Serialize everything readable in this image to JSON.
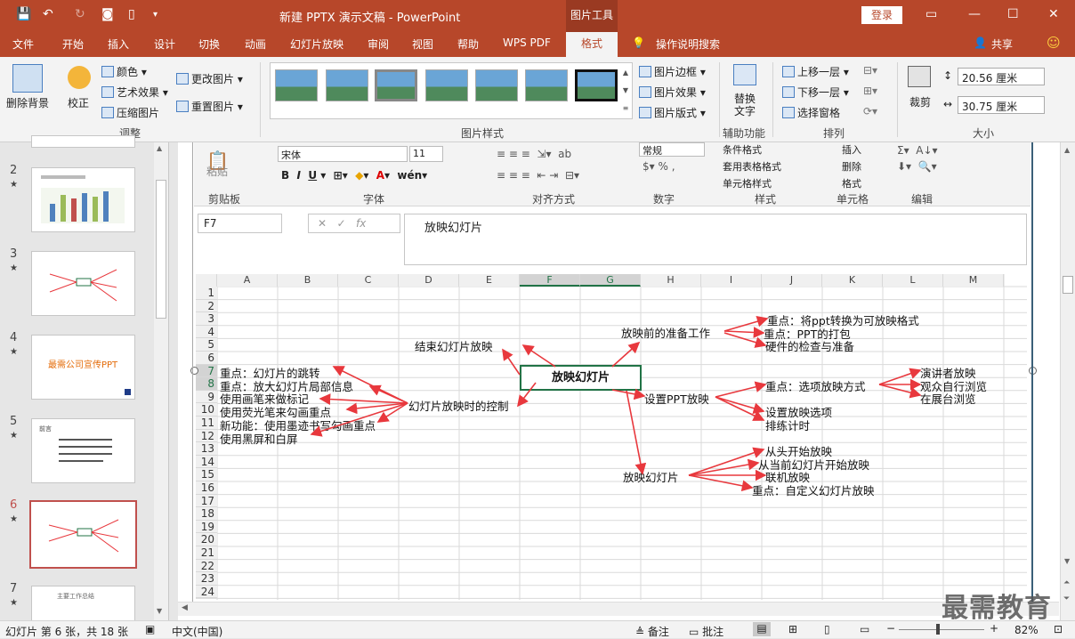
{
  "app": {
    "title": "新建 PPTX 演示文稿 - PowerPoint",
    "context_tab_title": "图片工具",
    "login_label": "登录"
  },
  "tabs": [
    "文件",
    "开始",
    "插入",
    "设计",
    "切换",
    "动画",
    "幻灯片放映",
    "审阅",
    "视图",
    "帮助",
    "WPS PDF",
    "格式",
    "操作说明搜索",
    "共享"
  ],
  "ribbon": {
    "adjust": {
      "remove_bg": "删除背景",
      "correct": "校正",
      "color": "颜色",
      "artistic": "艺术效果",
      "compress": "压缩图片",
      "change": "更改图片",
      "reset": "重置图片",
      "label": "调整"
    },
    "styles": {
      "label": "图片样式",
      "border": "图片边框",
      "effect": "图片效果",
      "layout": "图片版式"
    },
    "accessibility": {
      "alt_text": "替换文字",
      "label": "辅助功能"
    },
    "arrange": {
      "bring_forward": "上移一层",
      "send_backward": "下移一层",
      "selection_pane": "选择窗格",
      "label": "排列"
    },
    "size": {
      "crop": "裁剪",
      "height": "20.56 厘米",
      "width": "30.75 厘米",
      "label": "大小"
    }
  },
  "slides": [
    {
      "num": "2",
      "star": "★"
    },
    {
      "num": "3",
      "star": "★"
    },
    {
      "num": "4",
      "star": "★"
    },
    {
      "num": "5",
      "star": "★"
    },
    {
      "num": "6",
      "star": "★"
    },
    {
      "num": "7",
      "star": "★"
    }
  ],
  "thumb_text": {
    "s4": "最需公司宣传PPT",
    "s5": "前言",
    "s7": "主要工作总结"
  },
  "excel": {
    "ribbon": {
      "paste": "粘贴",
      "clipboard": "剪贴板",
      "font_name": "宋体",
      "font_size": "11",
      "font": "字体",
      "align": "对齐方式",
      "number_format": "常规",
      "number": "数字",
      "cond_format": "条件格式",
      "table_format": "套用表格格式",
      "cell_style": "单元格样式",
      "style": "样式",
      "insert": "插入",
      "delete": "删除",
      "format": "格式",
      "cells": "单元格",
      "edit": "编辑"
    },
    "name_box": "F7",
    "fx": "fx",
    "formula": "放映幻灯片",
    "columns": [
      "A",
      "B",
      "C",
      "D",
      "E",
      "F",
      "G",
      "H",
      "I",
      "J",
      "K",
      "L",
      "M"
    ],
    "rows": [
      "1",
      "2",
      "3",
      "4",
      "5",
      "6",
      "7",
      "8",
      "9",
      "10",
      "11",
      "12",
      "13",
      "14",
      "15",
      "16",
      "17",
      "18",
      "19",
      "20",
      "21",
      "22",
      "23",
      "24"
    ]
  },
  "mindmap": {
    "center": "放映幻灯片",
    "left_branch": "幻灯片放映时的控制",
    "left_items": [
      "重点：幻灯片的跳转",
      "重点：放大幻灯片局部信息",
      "使用画笔来做标记",
      "使用荧光笔来勾画重点",
      "新功能：使用墨迹书写勾画重点",
      "使用黑屏和白屏"
    ],
    "end_show": "结束幻灯片放映",
    "prep": "放映前的准备工作",
    "prep_items": [
      "重点：将ppt转换为可放映格式",
      "重点：PPT的打包",
      "硬件的检查与准备"
    ],
    "setup": "设置PPT放映",
    "setup_key": "重点：选项放映方式",
    "setup_key_items": [
      "演讲者放映",
      "观众自行浏览",
      "在展台浏览"
    ],
    "setup_items": [
      "设置放映选项",
      "排练计时"
    ],
    "show": "放映幻灯片",
    "show_items": [
      "从头开始放映",
      "从当前幻灯片开始放映",
      "联机放映",
      "重点：自定义幻灯片放映"
    ]
  },
  "status": {
    "slide_info": "幻灯片 第 6 张，共 18 张",
    "language": "中文(中国)",
    "notes": "备注",
    "comments": "批注",
    "zoom": "82%"
  },
  "watermark": "最需教育",
  "colors": {
    "brand": "#b7472a",
    "arrow": "#e8383d",
    "excel_green": "#217346"
  }
}
